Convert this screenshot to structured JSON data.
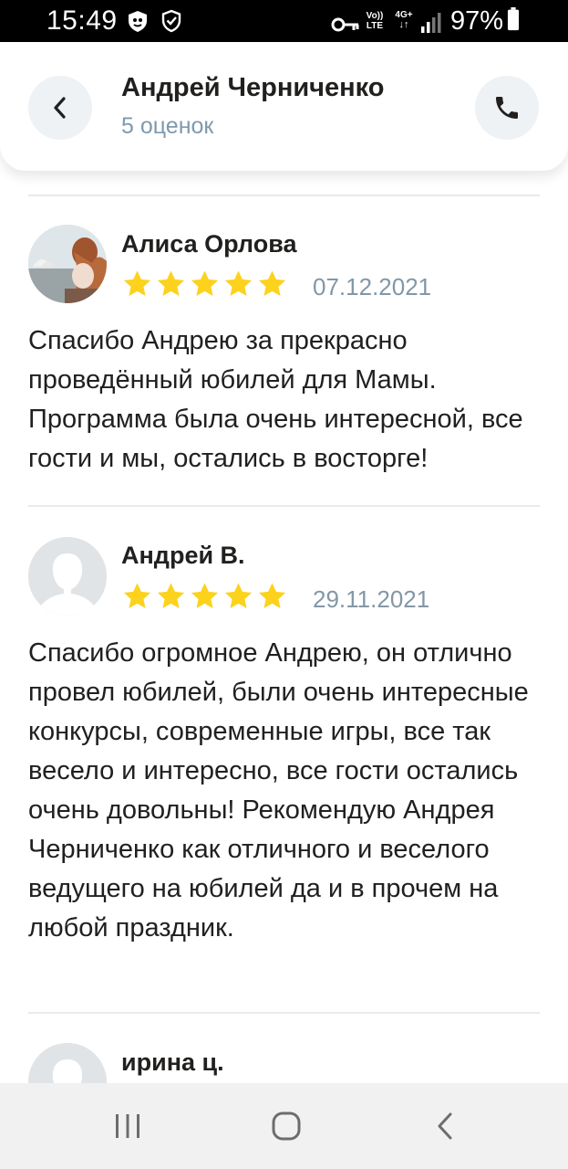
{
  "status_bar": {
    "time": "15:49",
    "battery": "97%",
    "icons": [
      "shield-app-icon",
      "shield-check-icon",
      "key-icon",
      "volte-icon",
      "4g-data-icon",
      "signal-icon",
      "battery-icon"
    ],
    "volte_label_top": "Vo))",
    "volte_label_bottom": "LTE",
    "network_label": "4G+"
  },
  "header": {
    "title": "Андрей Черниченко",
    "subtitle": "5 оценок",
    "back_icon": "chevron-left-icon",
    "call_icon": "phone-icon"
  },
  "colors": {
    "star": "#fcd21d",
    "accent_gray": "#7e9aad",
    "button_bg": "#eef2f5"
  },
  "reviews": [
    {
      "name": "Алиса Орлова",
      "rating": 5,
      "date": "07.12.2021",
      "avatar": "photo-avatar",
      "text": "Спасибо Андрею за прекрасно проведённый юбилей для Мамы. Программа была очень интересной, все гости и мы, остались в восторге!"
    },
    {
      "name": "Андрей В.",
      "rating": 5,
      "date": "29.11.2021",
      "avatar": "default-avatar",
      "text": "Спасибо огромное Андрею, он отлично провел юбилей, были очень интересные конкурсы, современные игры, все так весело и интересно, все гости остались очень довольны! Рекомендую Андрея Черниченко как отличного и веселого ведущего на юбилей да и в прочем на любой праздник."
    },
    {
      "name": "ирина ц.",
      "avatar": "default-avatar"
    }
  ],
  "nav_bar": {
    "recent_icon": "recent-apps-icon",
    "home_icon": "home-icon",
    "back_icon": "back-icon"
  }
}
